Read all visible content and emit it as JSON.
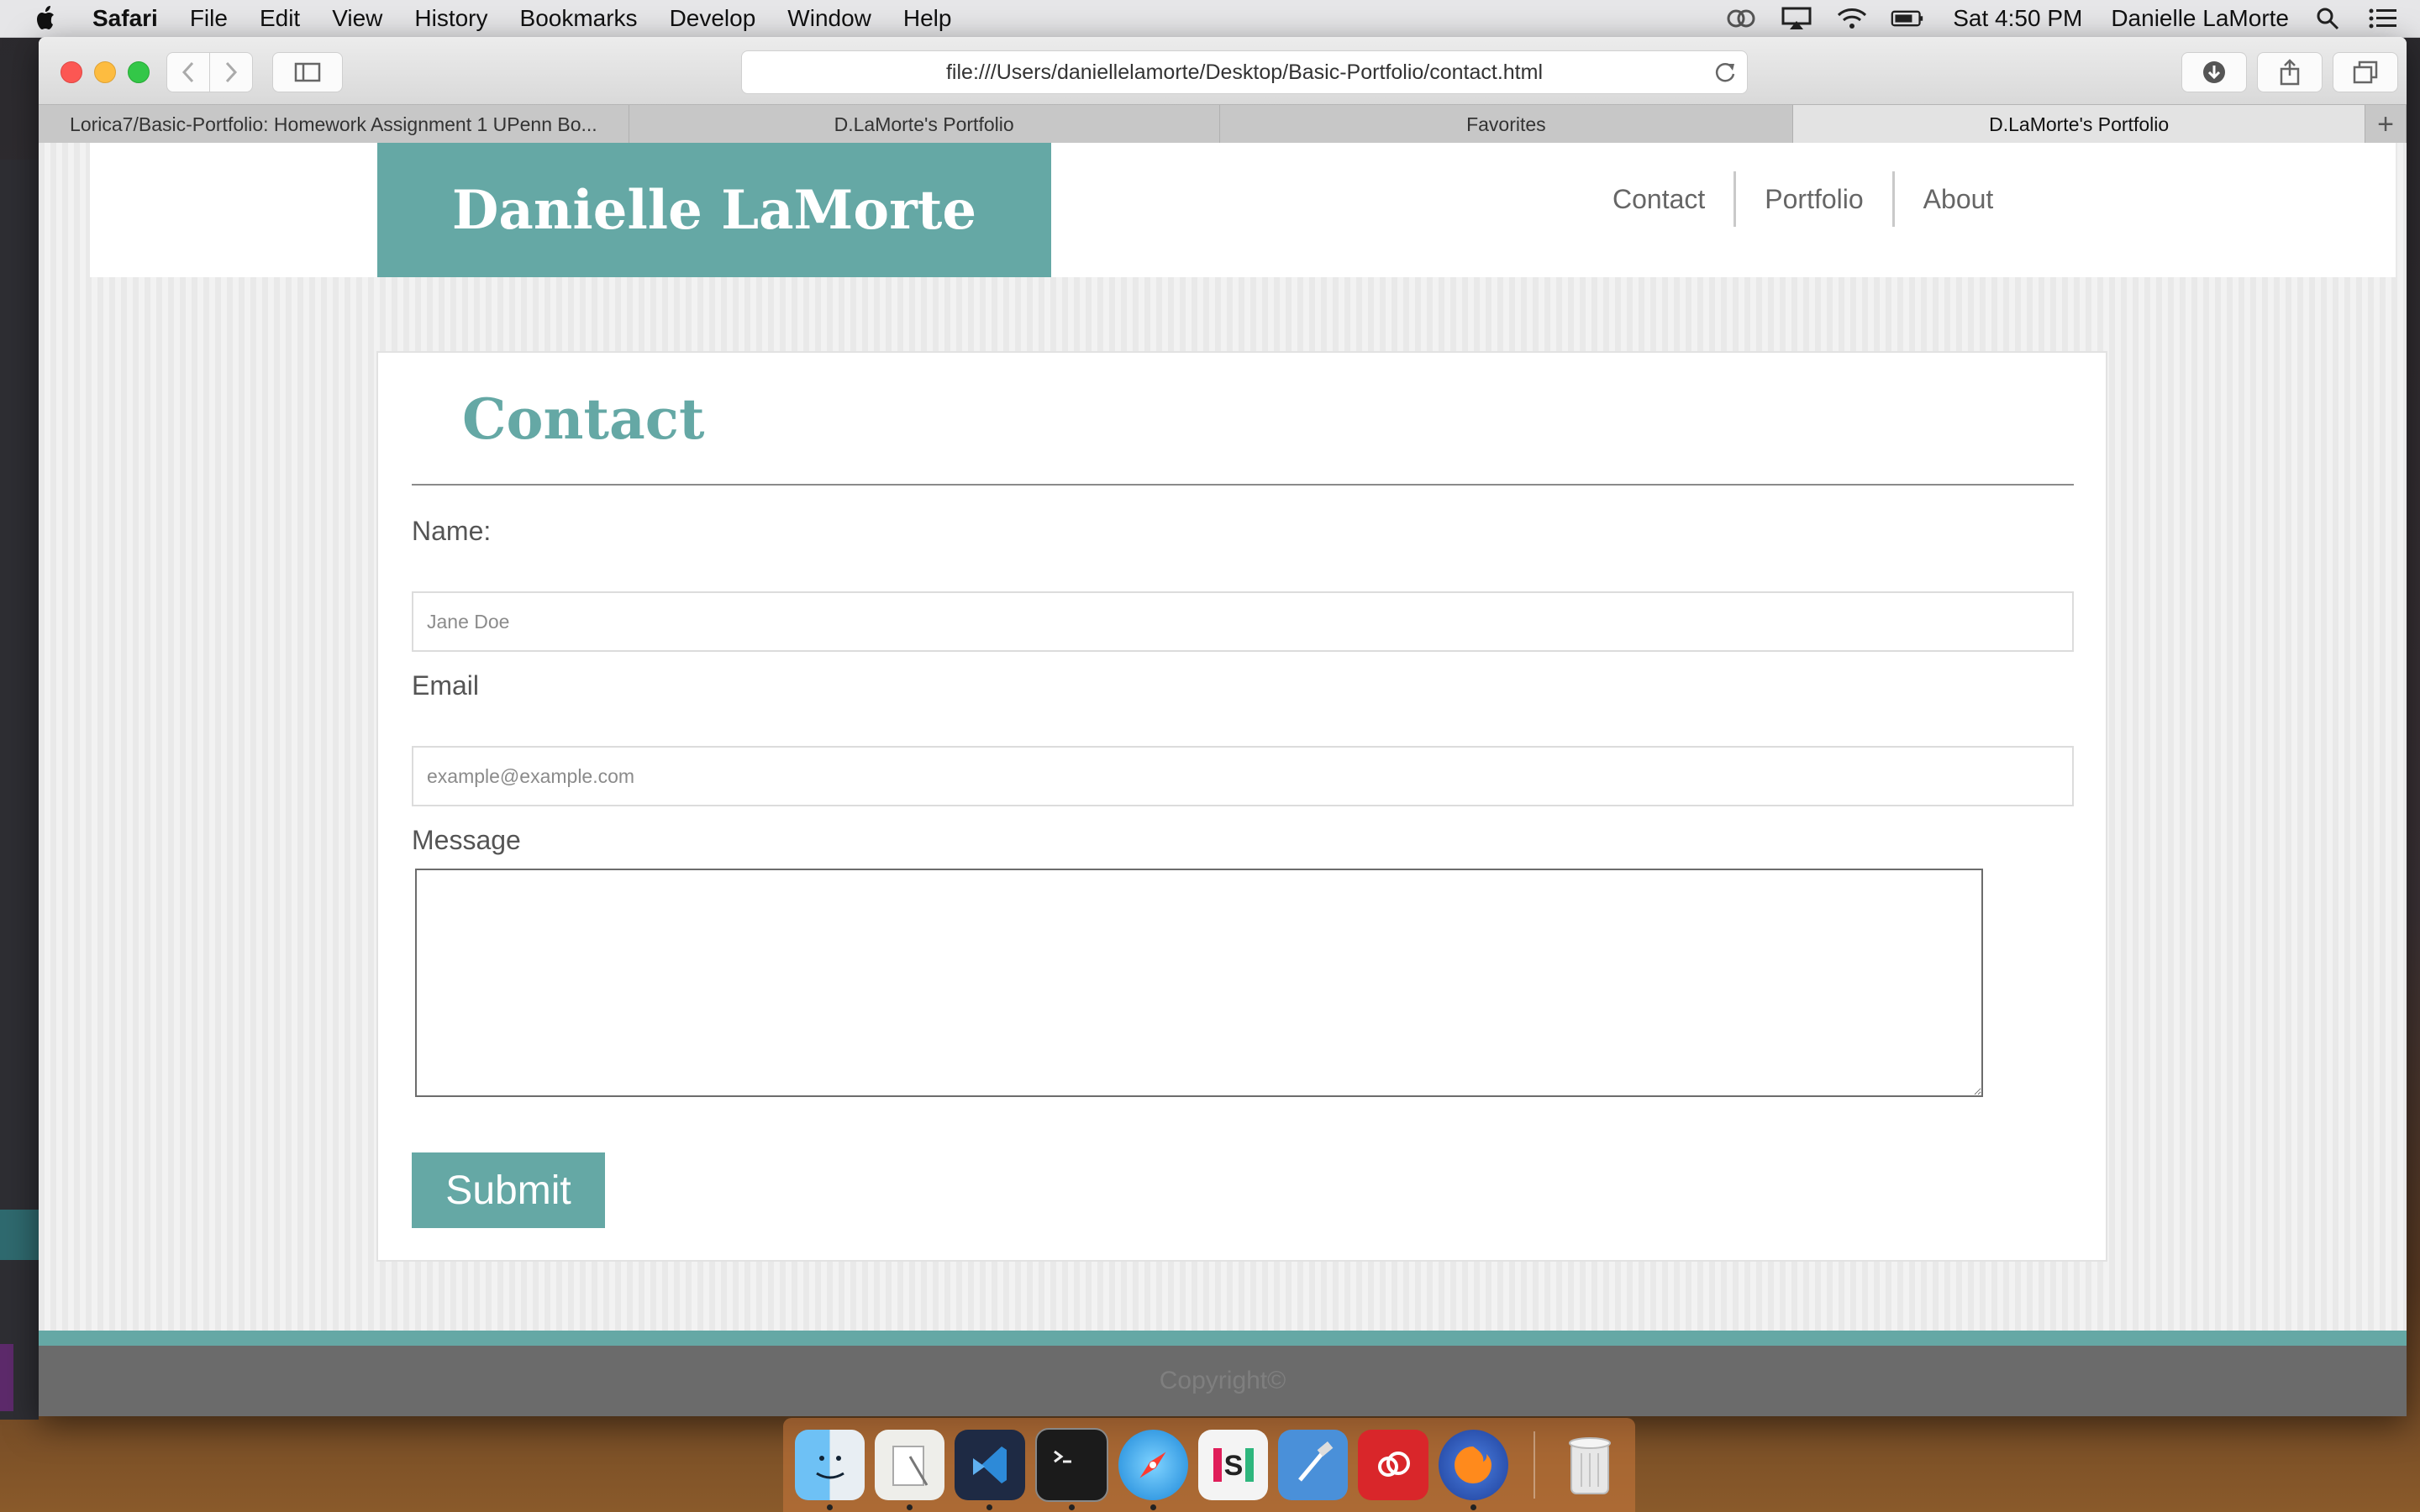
{
  "menubar": {
    "app_name": "Safari",
    "items": [
      "File",
      "Edit",
      "View",
      "History",
      "Bookmarks",
      "Develop",
      "Window",
      "Help"
    ],
    "clock": "Sat 4:50 PM",
    "user": "Danielle LaMorte"
  },
  "browser": {
    "url": "file:///Users/daniellelamorte/Desktop/Basic-Portfolio/contact.html",
    "tabs": [
      {
        "label": "Lorica7/Basic-Portfolio: Homework Assignment 1 UPenn Bo..."
      },
      {
        "label": "D.LaMorte's Portfolio"
      },
      {
        "label": "Favorites"
      },
      {
        "label": "D.LaMorte's Portfolio"
      }
    ],
    "new_tab_symbol": "+"
  },
  "site": {
    "brand": "Danielle LaMorte",
    "nav": [
      "Contact",
      "Portfolio",
      "About"
    ]
  },
  "contact": {
    "title": "Contact",
    "name_label": "Name:",
    "name_placeholder": "Jane Doe",
    "email_label": "Email",
    "email_placeholder": "example@example.com",
    "message_label": "Message",
    "submit_label": "Submit"
  },
  "footer": {
    "text": "Copyright©"
  },
  "colors": {
    "accent": "#65a8a5",
    "footer_bg": "#6b6b6b"
  },
  "dock": {
    "apps": [
      "finder",
      "preview",
      "vscode",
      "terminal",
      "safari",
      "slack",
      "xcode",
      "creative-cloud",
      "firefox",
      "trash"
    ]
  }
}
